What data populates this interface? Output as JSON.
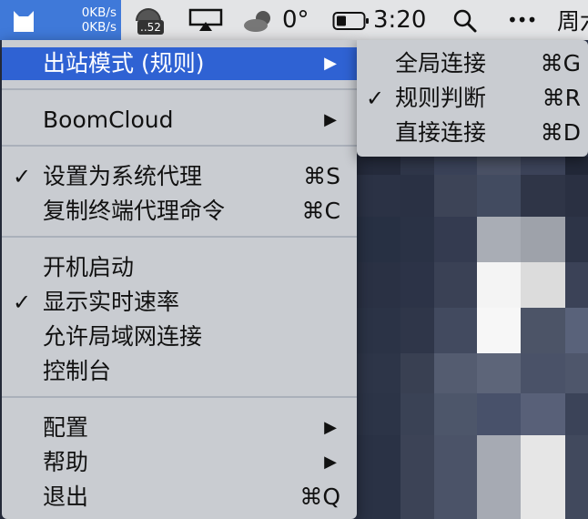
{
  "menubar": {
    "upload_speed": "0KB/s",
    "download_speed": "0KB/s",
    "badge": "..52",
    "temperature": "0°",
    "clock": "3:20",
    "more": "•••",
    "day_partial": "周六"
  },
  "main_menu": {
    "items": [
      {
        "label": "出站模式 (规则)",
        "check": "",
        "shortcut": "",
        "arrow": "▶"
      },
      {
        "label": "BoomCloud",
        "check": "",
        "shortcut": "",
        "arrow": "▶"
      },
      {
        "label": "设置为系统代理",
        "check": "✓",
        "shortcut": "⌘S",
        "arrow": ""
      },
      {
        "label": "复制终端代理命令",
        "check": "",
        "shortcut": "⌘C",
        "arrow": ""
      },
      {
        "label": "开机启动",
        "check": "",
        "shortcut": "",
        "arrow": ""
      },
      {
        "label": "显示实时速率",
        "check": "✓",
        "shortcut": "",
        "arrow": ""
      },
      {
        "label": "允许局域网连接",
        "check": "",
        "shortcut": "",
        "arrow": ""
      },
      {
        "label": "控制台",
        "check": "",
        "shortcut": "",
        "arrow": ""
      },
      {
        "label": "配置",
        "check": "",
        "shortcut": "",
        "arrow": "▶"
      },
      {
        "label": "帮助",
        "check": "",
        "shortcut": "",
        "arrow": "▶"
      },
      {
        "label": "退出",
        "check": "",
        "shortcut": "⌘Q",
        "arrow": ""
      }
    ]
  },
  "submenu": {
    "items": [
      {
        "label": "全局连接",
        "check": "",
        "shortcut": "⌘G"
      },
      {
        "label": "规则判断",
        "check": "✓",
        "shortcut": "⌘R"
      },
      {
        "label": "直接连接",
        "check": "",
        "shortcut": "⌘D"
      }
    ]
  },
  "colors": {
    "highlight": "#2f62d3",
    "menu_bg": "#c9ccd1",
    "menubar_bg": "#e3e4e6"
  }
}
